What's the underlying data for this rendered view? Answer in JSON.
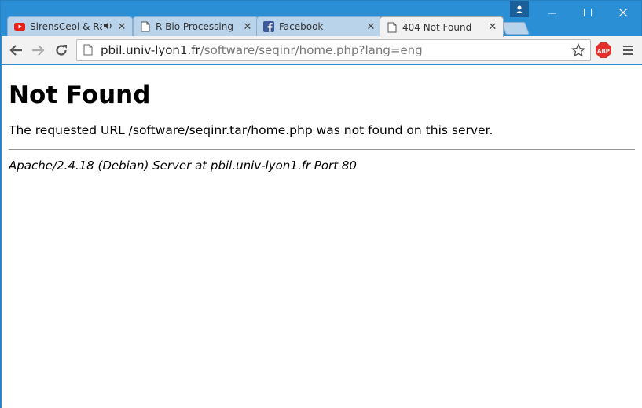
{
  "tabs": [
    {
      "title": "SirensCeol & Radio",
      "favicon": "youtube-icon",
      "audio": true,
      "active": false
    },
    {
      "title": "R Bio Processing",
      "favicon": "page-icon",
      "audio": false,
      "active": false
    },
    {
      "title": "Facebook",
      "favicon": "facebook-icon",
      "audio": false,
      "active": false
    },
    {
      "title": "404 Not Found",
      "favicon": "page-icon",
      "audio": false,
      "active": true
    }
  ],
  "address_bar": {
    "host": "pbil.univ-lyon1.fr",
    "path": "/software/seqinr/home.php?lang=eng"
  },
  "page": {
    "heading": "Not Found",
    "message": "The requested URL /software/seqinr.tar/home.php was not found on this server.",
    "server_signature": "Apache/2.4.18 (Debian) Server at pbil.univ-lyon1.fr Port 80"
  },
  "extensions": {
    "abp_label": "ABP"
  },
  "colors": {
    "titlebar": "#2b8fd6",
    "abp_red": "#e0302a",
    "youtube_red": "#e62117",
    "facebook_blue": "#3b5998"
  }
}
